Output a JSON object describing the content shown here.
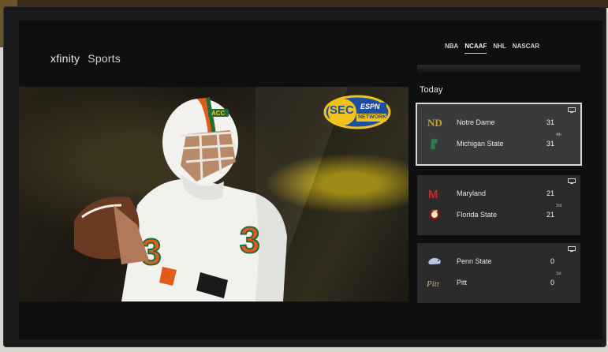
{
  "app": {
    "brand": "xfinity",
    "product": "Sports"
  },
  "tabs": [
    {
      "label": "NBA",
      "active": false
    },
    {
      "label": "NCAAF",
      "active": true
    },
    {
      "label": "NHL",
      "active": false
    },
    {
      "label": "NASCAR",
      "active": false
    }
  ],
  "hero": {
    "sponsor_logo": {
      "top": "ESPN",
      "main": "SEC",
      "bottom": "NETWORK"
    },
    "player": {
      "helmet_label": "ACC",
      "jersey_number": "3"
    }
  },
  "section_title": "Today",
  "games": [
    {
      "selected": true,
      "teams": [
        {
          "name": "Notre Dame",
          "score": "31",
          "logo": "notre-dame-logo"
        },
        {
          "name": "Michigan State",
          "score": "31",
          "logo": "michigan-state-logo"
        }
      ],
      "period": "4th"
    },
    {
      "selected": false,
      "teams": [
        {
          "name": "Maryland",
          "score": "21",
          "logo": "maryland-logo"
        },
        {
          "name": "Florida State",
          "score": "21",
          "logo": "florida-state-logo"
        }
      ],
      "period": "3rd"
    },
    {
      "selected": false,
      "teams": [
        {
          "name": "Penn State",
          "score": "0",
          "logo": "penn-state-logo"
        },
        {
          "name": "Pitt",
          "score": "0",
          "logo": "pitt-logo"
        }
      ],
      "period": "1st"
    }
  ],
  "colors": {
    "background": "#0f0f10",
    "card": "#2b2b2b",
    "card_selected_border": "#d8d8d8",
    "sec_blue": "#1d4ea3",
    "sec_gold": "#f0c21c",
    "helmet_orange": "#e35b1b",
    "helmet_green": "#1f6b3a"
  }
}
